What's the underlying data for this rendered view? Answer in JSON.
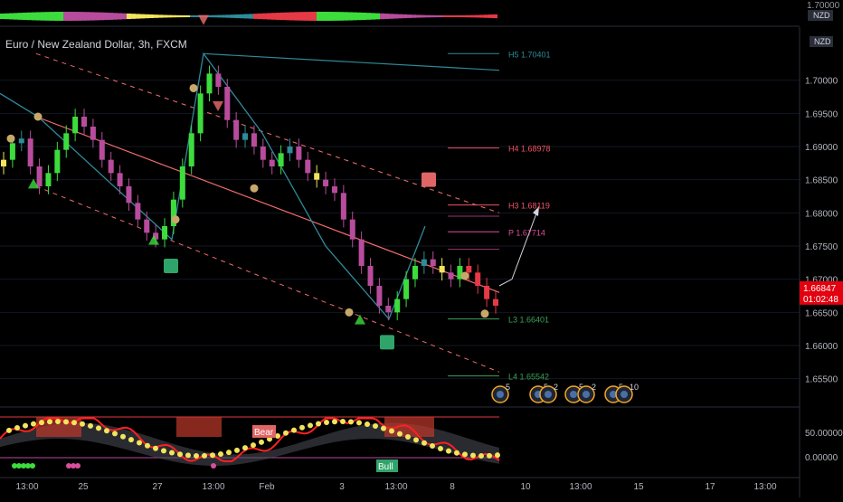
{
  "symbol_title": "Euro / New Zealand Dollar, 3h, FXCM",
  "currency": "NZD",
  "top_strip": {
    "price_label": "1.70000"
  },
  "price_axis": {
    "ticks": [
      "1.70000",
      "1.69500",
      "1.69000",
      "1.68500",
      "1.68000",
      "1.67500",
      "1.67000",
      "1.66500",
      "1.66000",
      "1.65500"
    ]
  },
  "current_price": {
    "value": "1.66847",
    "countdown": "01:02:48",
    "color": "#e3000f"
  },
  "pivots": [
    {
      "label": "H5",
      "value": 1.70401,
      "color": "#2e8b9a"
    },
    {
      "label": "H4",
      "value": 1.68978,
      "color": "#f05464"
    },
    {
      "label": "H3",
      "value": 1.68119,
      "color": "#f05464"
    },
    {
      "label": "P",
      "value": 1.67714,
      "color": "#d94f9c"
    },
    {
      "label": "L3",
      "value": 1.66401,
      "color": "#3ca35a"
    },
    {
      "label": "L4",
      "value": 1.65542,
      "color": "#3ca35a"
    }
  ],
  "time_axis": {
    "ticks": [
      "13:00",
      "25",
      "27",
      "13:00",
      "Feb",
      "3",
      "13:00",
      "8",
      "10",
      "13:00",
      "15",
      "17",
      "13:00"
    ]
  },
  "oscillator": {
    "ticks": [
      "50.00000",
      "0.00000"
    ],
    "bear_label": "Bear",
    "bull_label": "Bull"
  },
  "event_badges": [
    "5",
    "5",
    "2",
    "5",
    "2",
    "5",
    "10"
  ],
  "colors": {
    "bull": "#3ddc3d",
    "bear": "#e63946",
    "neutral": "#b84c9c",
    "teal": "#2e8b9a",
    "yellow": "#f2e45c",
    "channel": "#f26d6d"
  },
  "chart_data": {
    "type": "candlestick",
    "title": "Euro / New Zealand Dollar, 3h, FXCM",
    "ylabel": "NZD",
    "ylim": [
      1.651,
      1.708
    ],
    "series": [
      {
        "name": "EUR/NZD",
        "values": [
          1.688,
          1.6905,
          1.6912,
          1.687,
          1.684,
          1.686,
          1.6895,
          1.692,
          1.6945,
          1.693,
          1.691,
          1.688,
          1.686,
          1.684,
          1.6815,
          1.679,
          1.677,
          1.676,
          1.678,
          1.682,
          1.687,
          1.692,
          1.698,
          1.701,
          1.699,
          1.694,
          1.691,
          1.692,
          1.69,
          1.688,
          1.687,
          1.689,
          1.69,
          1.688,
          1.686,
          1.685,
          1.684,
          1.683,
          1.679,
          1.676,
          1.672,
          1.669,
          1.666,
          1.665,
          1.667,
          1.67,
          1.672,
          1.673,
          1.672,
          1.671,
          1.67,
          1.672,
          1.671,
          1.669,
          1.667,
          1.666
        ]
      }
    ]
  }
}
